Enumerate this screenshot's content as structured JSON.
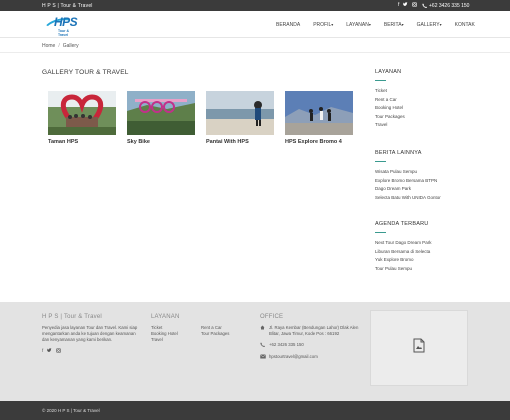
{
  "topbar": {
    "brand": "H P S | Tour & Travel",
    "social_icons": [
      "facebook-icon",
      "twitter-icon",
      "instagram-icon"
    ],
    "phone": "+62 3426 335 150"
  },
  "nav": {
    "logo_text": "HPS",
    "logo_sub": "Tour & Travel",
    "items": [
      {
        "label": "BERANDA",
        "caret": ""
      },
      {
        "label": "PROFIL",
        "caret": "▾"
      },
      {
        "label": "LAYANAN",
        "caret": "▾"
      },
      {
        "label": "BERITA",
        "caret": "▾"
      },
      {
        "label": "GALLERY",
        "caret": "▾"
      },
      {
        "label": "KONTAK",
        "caret": ""
      }
    ]
  },
  "breadcrumb": {
    "home": "Home",
    "separator": "/",
    "current": "Gallery"
  },
  "gallery": {
    "title": "GALLERY TOUR & TRAVEL",
    "items": [
      {
        "caption": "Taman HPS"
      },
      {
        "caption": "Sky Bike"
      },
      {
        "caption": "Pantai With HPS"
      },
      {
        "caption": "HPS Explore Bromo 4"
      }
    ]
  },
  "sidebar": {
    "layanan": {
      "title": "LAYANAN",
      "items": [
        "Ticket",
        "Rent a Car",
        "Booking Hotel",
        "Tour Packages",
        "Travel"
      ]
    },
    "berita": {
      "title": "BERITA LAINNYA",
      "items": [
        "Wisata Pulau Sempu",
        "Explore Bromo Bersama BTPN",
        "Dago Dream Park",
        "Selecta Batu With UNIDA Gontor"
      ]
    },
    "agenda": {
      "title": "AGENDA TERBARU",
      "items": [
        "Next Tour Dago Dream Park",
        "Liburan Bersama di Selecta",
        "Yuk Explore Bromo",
        "Tour Pulau Sempu"
      ]
    }
  },
  "footer": {
    "about": {
      "title": "H P S | Tour & Travel",
      "text": "Penyedia jasa layanan Tour dan Travel. Kami siap mengantarkan anda ke tujuan dengan keamanan dan kenyamanan yang kami berikan."
    },
    "layanan": {
      "title": "LAYANAN",
      "col1": [
        "Ticket",
        "Booking Hotel",
        "Travel"
      ],
      "col2": [
        "Rent a Car",
        "Tour Packages"
      ]
    },
    "office": {
      "title": "OFFICE",
      "address": "Jl. Raya Kembar (Bendungan Lahor) Dlak Alen Blitar, Jawa Timur, Kode Pos : 66192",
      "phone": "+62 3426 335 150",
      "email": "hpstourtravel@gmail.com"
    }
  },
  "copyright": "© 2020 H P S | Tour & Travel"
}
